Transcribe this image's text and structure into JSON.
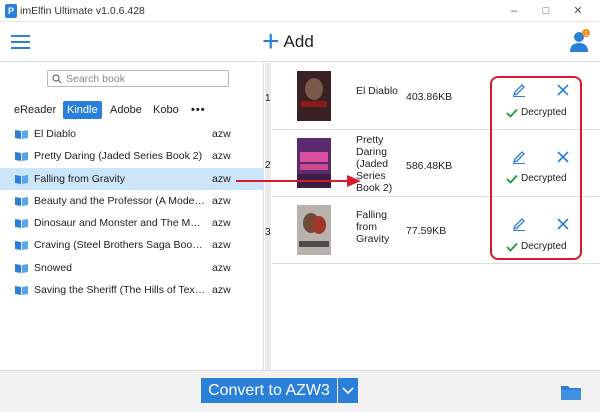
{
  "window": {
    "title": "imElfin Ultimate v1.0.6.428",
    "app_icon": "P",
    "controls": {
      "minimize": "–",
      "maximize": "□",
      "close": "✕"
    }
  },
  "header": {
    "add_label": "Add",
    "add_icon": "+",
    "notification_count": "1"
  },
  "search": {
    "placeholder": "Search book"
  },
  "tabs": [
    {
      "label": "eReader",
      "active": false
    },
    {
      "label": "Kindle",
      "active": true
    },
    {
      "label": "Adobe",
      "active": false
    },
    {
      "label": "Kobo",
      "active": false
    },
    {
      "label": "•••",
      "active": false
    }
  ],
  "books": [
    {
      "title": "El Diablo",
      "format": "azw"
    },
    {
      "title": "Pretty Daring (Jaded Series Book 2)",
      "format": "azw"
    },
    {
      "title": "Falling from Gravity",
      "format": "azw"
    },
    {
      "title": "Beauty and the Professor (A Modern F...",
      "format": "azw"
    },
    {
      "title": "Dinosaur and Monster and The Magic ...",
      "format": "azw"
    },
    {
      "title": "Craving (Steel Brothers Saga Book 1)",
      "format": "azw"
    },
    {
      "title": "Snowed",
      "format": "azw"
    },
    {
      "title": "Saving the Sheriff (The Hills of Texas B...",
      "format": "azw"
    }
  ],
  "queue": [
    {
      "index": "1",
      "title": "El Diablo",
      "size": "403.86KB",
      "status": "Decrypted"
    },
    {
      "index": "2",
      "title": "Pretty Daring (Jaded Series Book 2)",
      "size": "586.48KB",
      "status": "Decrypted"
    },
    {
      "index": "3",
      "title": "Falling from Gravity",
      "size": "77.59KB",
      "status": "Decrypted"
    }
  ],
  "colors": {
    "accent": "#2a7fd9",
    "selected_row": "#cde5f8",
    "highlight_red": "#d61b2a",
    "success_green": "#1a9a3a"
  },
  "bottom": {
    "convert_label": "Convert to AZW3",
    "dropdown_icon": "chevron-down-icon",
    "folder_icon": "folder-icon"
  }
}
